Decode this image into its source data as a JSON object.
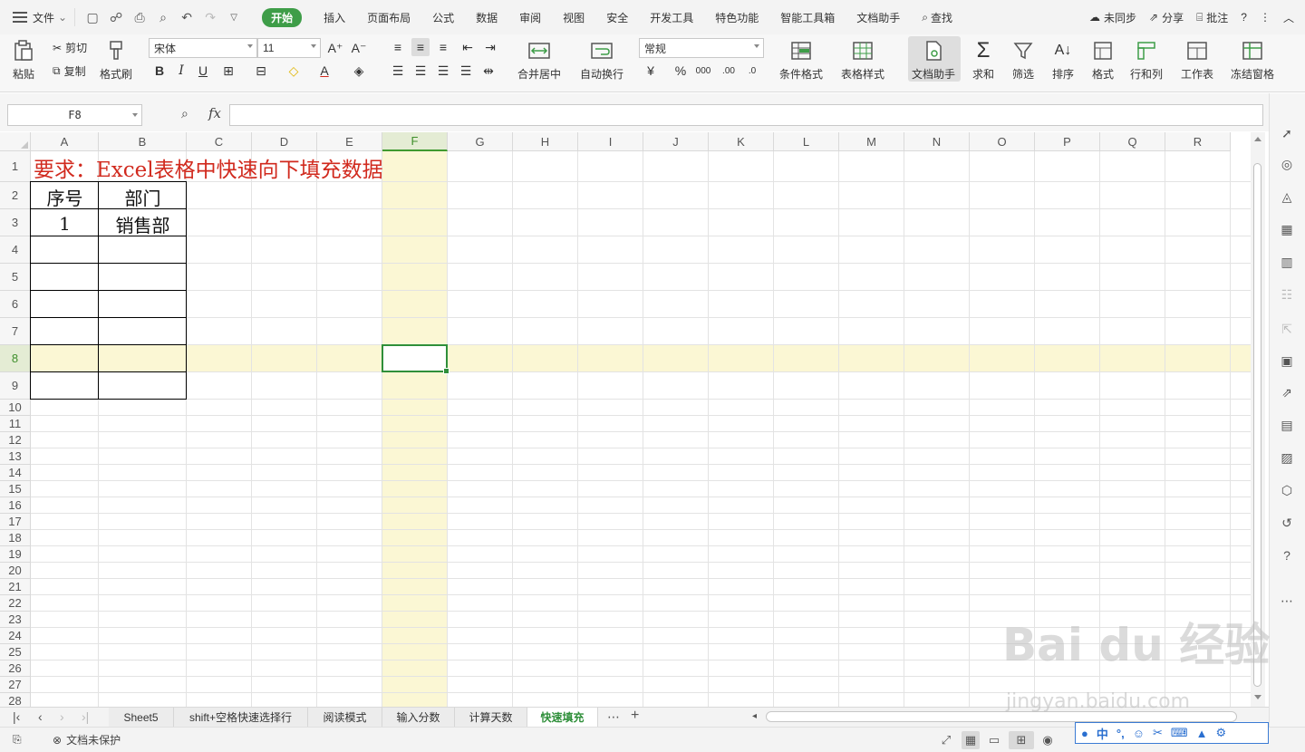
{
  "menubar": {
    "file_label": "文件",
    "tabs": [
      {
        "label": "开始",
        "active": true
      },
      {
        "label": "插入"
      },
      {
        "label": "页面布局"
      },
      {
        "label": "公式"
      },
      {
        "label": "数据"
      },
      {
        "label": "审阅"
      },
      {
        "label": "视图"
      },
      {
        "label": "安全"
      },
      {
        "label": "开发工具"
      },
      {
        "label": "特色功能"
      },
      {
        "label": "智能工具箱"
      },
      {
        "label": "文档助手"
      }
    ],
    "search_label": "查找",
    "sync_label": "未同步",
    "share_label": "分享",
    "comment_label": "批注"
  },
  "ribbon": {
    "paste": "粘贴",
    "cut": "剪切",
    "copy": "复制",
    "format_painter": "格式刷",
    "font_name": "宋体",
    "font_size": "11",
    "merge_center": "合并居中",
    "wrap_text": "自动换行",
    "number_format": "常规",
    "conditional_format": "条件格式",
    "table_style": "表格样式",
    "doc_assistant": "文档助手",
    "sum": "求和",
    "filter": "筛选",
    "sort": "排序",
    "format": "格式",
    "row_col": "行和列",
    "worksheet": "工作表",
    "freeze": "冻结窗格"
  },
  "formula_bar": {
    "cell_ref": "F8",
    "fx_label": "fx",
    "formula": ""
  },
  "grid": {
    "columns": [
      "A",
      "B",
      "C",
      "D",
      "E",
      "F",
      "G",
      "H",
      "I",
      "J",
      "K",
      "L",
      "M",
      "N",
      "O",
      "P",
      "Q",
      "R"
    ],
    "rows": [
      "1",
      "2",
      "3",
      "4",
      "5",
      "6",
      "7",
      "8",
      "9",
      "10",
      "11",
      "12",
      "13",
      "14",
      "15",
      "16",
      "17",
      "18",
      "19",
      "20",
      "21",
      "22",
      "23",
      "24",
      "25",
      "26",
      "27",
      "28"
    ],
    "selected_column": "F",
    "selected_row": "8",
    "title": "要求：Excel表格中快速向下填充数据",
    "header_seq": "序号",
    "header_dept": "部门",
    "row3_seq": "1",
    "row3_dept": "销售部"
  },
  "sheet_tabs": [
    {
      "label": "Sheet5"
    },
    {
      "label": "shift+空格快速选择行"
    },
    {
      "label": "阅读模式"
    },
    {
      "label": "输入分数"
    },
    {
      "label": "计算天数"
    },
    {
      "label": "快速填充",
      "active": true
    }
  ],
  "status": {
    "protection": "文档未保护"
  },
  "ime": {
    "mode": "中"
  },
  "watermark": {
    "brand": "Bai du 经验",
    "url": "jingyan.baidu.com"
  },
  "colors": {
    "accent": "#3e9d48",
    "title_red": "#d12a1e",
    "highlight": "#fbf7d4"
  }
}
